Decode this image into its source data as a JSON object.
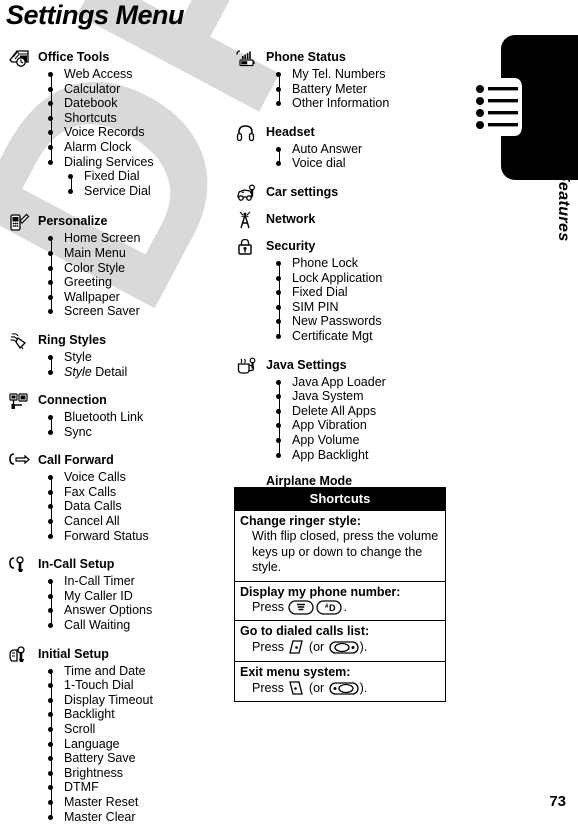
{
  "page": {
    "title": "Settings Menu",
    "number": "73",
    "watermark": "DRAFT",
    "side_tab_label": "Phone Features",
    "side_tab_icon": "bulleted-list-icon"
  },
  "left_column": [
    {
      "icon": "office-tools-icon",
      "label": "Office Tools",
      "items": [
        "Web Access",
        "Calculator",
        "Datebook",
        "Shortcuts",
        "Voice Records",
        "Alarm Clock",
        "Dialing Services"
      ],
      "subitems": [
        "Fixed Dial",
        "Service Dial"
      ]
    },
    {
      "icon": "personalize-icon",
      "label": "Personalize",
      "items": [
        "Home Screen",
        "Main Menu",
        "Color Style",
        "Greeting",
        "Wallpaper",
        "Screen Saver"
      ]
    },
    {
      "icon": "ring-styles-icon",
      "label": "Ring Styles",
      "items": [
        "Style"
      ],
      "items_italic": [
        {
          "italic": "Style",
          "rest": " Detail"
        }
      ]
    },
    {
      "icon": "connection-icon",
      "label": "Connection",
      "items": [
        "Bluetooth Link",
        "Sync"
      ]
    },
    {
      "icon": "call-forward-icon",
      "label": "Call Forward",
      "items": [
        "Voice Calls",
        "Fax Calls",
        "Data Calls",
        "Cancel All",
        "Forward Status"
      ]
    },
    {
      "icon": "in-call-setup-icon",
      "label": "In-Call Setup",
      "items": [
        "In-Call Timer",
        "My Caller ID",
        "Answer Options",
        "Call Waiting"
      ]
    },
    {
      "icon": "initial-setup-icon",
      "label": "Initial Setup",
      "items": [
        "Time and Date",
        "1-Touch Dial",
        "Display Timeout",
        "Backlight",
        "Scroll",
        "Language",
        "Battery Save",
        "Brightness",
        "DTMF",
        "Master Reset",
        "Master Clear"
      ]
    }
  ],
  "right_column": [
    {
      "icon": "phone-status-icon",
      "label": "Phone Status",
      "items": [
        "My Tel. Numbers",
        "Battery Meter",
        "Other Information"
      ]
    },
    {
      "icon": "headset-icon",
      "label": "Headset",
      "items": [
        "Auto Answer",
        "Voice dial"
      ]
    },
    {
      "icon": "car-settings-icon",
      "label": "Car settings",
      "items": []
    },
    {
      "icon": "network-icon",
      "label": "Network",
      "items": []
    },
    {
      "icon": "security-icon",
      "label": "Security",
      "items": [
        "Phone Lock",
        "Lock Application",
        "Fixed Dial",
        "SIM PIN",
        "New Passwords",
        "Certificate Mgt"
      ]
    },
    {
      "icon": "java-settings-icon",
      "label": "Java Settings",
      "items": [
        "Java App Loader",
        "Java System",
        "Delete All Apps",
        "App Vibration",
        "App Volume",
        "App Backlight"
      ]
    }
  ],
  "airplane_mode_label": "Airplane Mode",
  "shortcuts": {
    "header": "Shortcuts",
    "rows": [
      {
        "title": "Change ringer style:",
        "body_pre": "With flip closed, press the volume keys up or down to change the style.",
        "body_post": ""
      },
      {
        "title": "Display my phone number:",
        "body_pre": "Press ",
        "key1": "menu-key-icon",
        "key2": "pound-d-key-icon",
        "body_post": "."
      },
      {
        "title": "Go to dialed calls list:",
        "body_pre": "Press ",
        "key1": "send-key-icon",
        "mid": " (or ",
        "key2": "right-soft-key-icon",
        "body_post": ")."
      },
      {
        "title": "Exit menu system:",
        "body_pre": "Press ",
        "key1": "end-key-icon",
        "mid": " (or ",
        "key2": "left-soft-key-icon",
        "body_post": ")."
      }
    ]
  }
}
